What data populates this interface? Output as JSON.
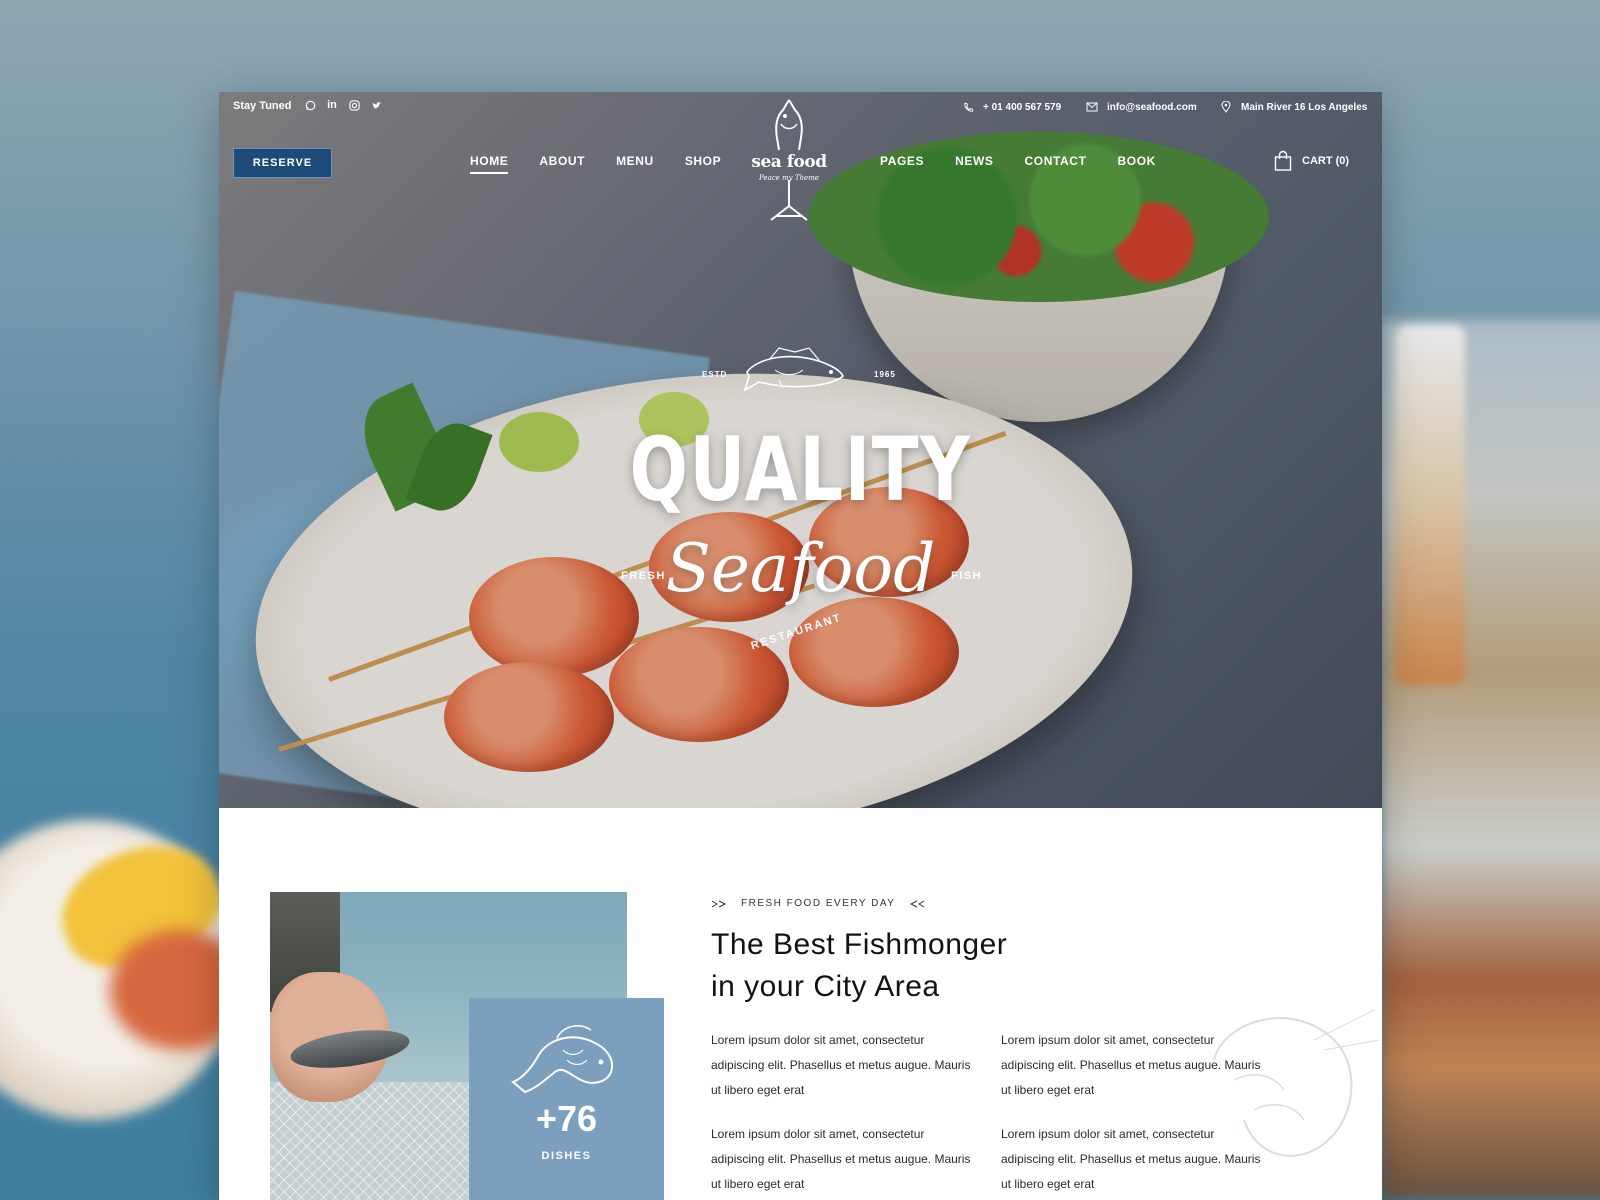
{
  "topbar": {
    "stay_tuned": "Stay Tuned",
    "social_icons": [
      "whatsapp-icon",
      "linkedin-icon",
      "instagram-icon",
      "twitter-icon"
    ],
    "phone": "+ 01 400 567 579",
    "email": "info@seafood.com",
    "address": "Main River 16 Los Angeles"
  },
  "nav": {
    "reserve_label": "RESERVE",
    "left_items": [
      "HOME",
      "ABOUT",
      "MENU",
      "SHOP"
    ],
    "right_items": [
      "PAGES",
      "NEWS",
      "CONTACT",
      "BOOK"
    ],
    "active": "HOME",
    "cart_label": "CART (0)"
  },
  "logo": {
    "name": "sea food",
    "tagline": "Peace my Theme"
  },
  "hero": {
    "estd": "ESTD",
    "year": "1965",
    "headline": "QUALITY",
    "script": "Seafood",
    "left_word": "FRESH",
    "right_word": "FISH",
    "arc_word": "RESTAURANT"
  },
  "about": {
    "kicker": "FRESH FOOD EVERY DAY",
    "heading_line1": "The Best Fishmonger",
    "heading_line2": "in your City Area",
    "paragraphs": [
      "Lorem ipsum dolor sit amet, consectetur adipiscing elit. Phasellus et metus augue. Mauris ut libero eget erat",
      "Lorem ipsum dolor sit amet, consectetur adipiscing elit. Phasellus et metus augue. Mauris ut libero eget erat",
      "Lorem ipsum dolor sit amet, consectetur adipiscing elit. Phasellus et metus augue. Mauris ut libero eget erat",
      "Lorem ipsum dolor sit amet, consectetur adipiscing elit. Phasellus et metus augue. Mauris ut libero eget erat"
    ],
    "badge_count": "+76",
    "badge_label": "DISHES"
  },
  "colors": {
    "reserve_bg": "#1d4a78",
    "badge_bg": "#7b9fbd",
    "heading": "#121212"
  }
}
